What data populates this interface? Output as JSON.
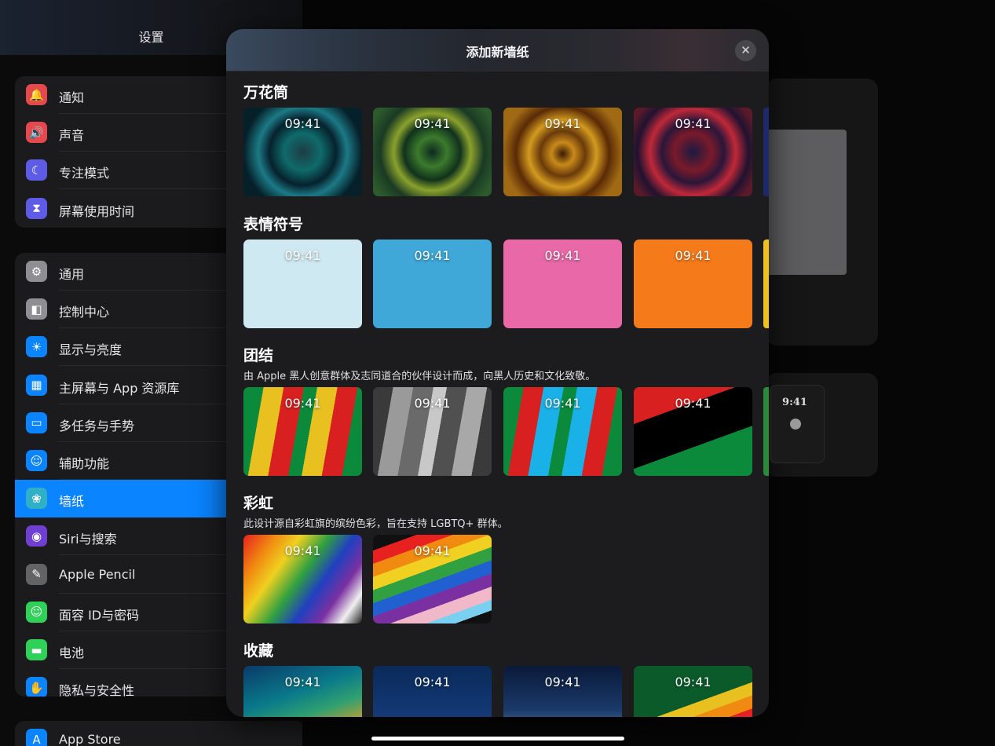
{
  "sidebar": {
    "title": "设置",
    "groups": [
      {
        "items": [
          {
            "label": "通知",
            "icon": "bell-icon",
            "color": "#e5484d",
            "glyph": "🔔"
          },
          {
            "label": "声音",
            "icon": "speaker-icon",
            "color": "#e5484d",
            "glyph": "🔊"
          },
          {
            "label": "专注模式",
            "icon": "moon-icon",
            "color": "#5e5ce6",
            "glyph": "☾"
          },
          {
            "label": "屏幕使用时间",
            "icon": "hourglass-icon",
            "color": "#5e5ce6",
            "glyph": "⧗"
          }
        ]
      },
      {
        "items": [
          {
            "label": "通用",
            "icon": "gear-icon",
            "color": "#8e8e93",
            "glyph": "⚙"
          },
          {
            "label": "控制中心",
            "icon": "switches-icon",
            "color": "#8e8e93",
            "glyph": "◧"
          },
          {
            "label": "显示与亮度",
            "icon": "sun-icon",
            "color": "#0a84ff",
            "glyph": "☀"
          },
          {
            "label": "主屏幕与 App 资源库",
            "icon": "home-screen-icon",
            "color": "#0a84ff",
            "glyph": "▦"
          },
          {
            "label": "多任务与手势",
            "icon": "multitasking-icon",
            "color": "#0a84ff",
            "glyph": "▭"
          },
          {
            "label": "辅助功能",
            "icon": "accessibility-icon",
            "color": "#0a84ff",
            "glyph": "☺"
          },
          {
            "label": "墙纸",
            "icon": "flower-icon",
            "color": "#30b0c7",
            "glyph": "❀",
            "selected": true
          },
          {
            "label": "Siri与搜索",
            "icon": "siri-icon",
            "color": "#6e3fd1",
            "glyph": "◉"
          },
          {
            "label": "Apple Pencil",
            "icon": "pencil-icon",
            "color": "#636366",
            "glyph": "✎"
          },
          {
            "label": "面容 ID与密码",
            "icon": "face-id-icon",
            "color": "#30d158",
            "glyph": "☺"
          },
          {
            "label": "电池",
            "icon": "battery-icon",
            "color": "#30d158",
            "glyph": "▬"
          },
          {
            "label": "隐私与安全性",
            "icon": "hand-icon",
            "color": "#0a84ff",
            "glyph": "✋"
          }
        ]
      },
      {
        "items": [
          {
            "label": "App Store",
            "icon": "app-store-icon",
            "color": "#0a84ff",
            "glyph": "A"
          }
        ]
      }
    ]
  },
  "modal": {
    "title": "添加新墙纸",
    "close_icon": "close-icon",
    "sections": [
      {
        "title": "万花筒",
        "desc": "",
        "count": 4,
        "peek_color": "#1c2a6a",
        "thumbs": [
          {
            "time": "09:41",
            "bg": "radial-gradient(circle at 50% 50%, #1d3c46 0%, #0f6a6a 25%, #06222e 45%, #1b7a86 60%, #052029 80%)"
          },
          {
            "time": "09:41",
            "bg": "radial-gradient(circle at 50% 50%, #0d2a20 0%, #3c7a2c 20%, #10321d 38%, #8aa12c 52%, #1a3a24 70%, #2c5a2c 90%)"
          },
          {
            "time": "09:41",
            "bg": "radial-gradient(circle at 50% 52%, #3a1a05 0%, #c88a1a 15%, #6a3a0a 30%, #d39a20 45%, #5a2a06 62%, #a06a14 80%)"
          },
          {
            "time": "09:41",
            "bg": "radial-gradient(circle at 50% 50%, #1a1a40 0%, #7a1a2a 25%, #2a163a 42%, #c02838 58%, #201230 75%, #5a1a2a 90%)"
          }
        ]
      },
      {
        "title": "表情符号",
        "desc": "",
        "count": 4,
        "peek_color": "#f0c020",
        "thumbs": [
          {
            "time": "09:41",
            "bg": "#cfe9f2"
          },
          {
            "time": "09:41",
            "bg": "#3fa8d8"
          },
          {
            "time": "09:41",
            "bg": "#e868a8"
          },
          {
            "time": "09:41",
            "bg": "#f47a1a"
          }
        ]
      },
      {
        "title": "团结",
        "desc": "由 Apple 黑人创意群体及志同道合的伙伴设计而成，向黑人历史和文化致敬。",
        "count": 4,
        "peek_color": "#2a8a3a",
        "thumbs": [
          {
            "time": "09:41",
            "bg": "linear-gradient(100deg, #0a8a3a 0 15%, #e8c020 15% 30%, #d82020 30% 45%, #0a8a3a 45% 55%, #e8c020 55% 70%, #d82020 70% 85%, #0a8a3a 85%)"
          },
          {
            "time": "09:41",
            "bg": "linear-gradient(100deg, #3a3a3a 0 15%, #9a9a9a 15% 30%, #6a6a6a 30% 45%, #c8c8c8 45% 55%, #505050 55% 70%, #a8a8a8 70% 85%, #3a3a3a 85%)"
          },
          {
            "time": "09:41",
            "bg": "linear-gradient(100deg, #0a8a3a 0 15%, #d82020 15% 30%, #1ab0e8 30% 45%, #0a8a3a 45% 55%, #1ab0e8 55% 70%, #d82020 70% 85%, #0a8a3a 85%)"
          },
          {
            "time": "09:41",
            "bg": "linear-gradient(160deg, #d82020 0 28%, #000 28% 62%, #0a8a3a 62%)"
          }
        ]
      },
      {
        "title": "彩虹",
        "desc": "此设计源自彩虹旗的缤纷色彩，旨在支持 LGBTQ+ 群体。",
        "count": 2,
        "peek_color": "",
        "thumbs": [
          {
            "time": "09:41",
            "bg": "linear-gradient(125deg, #e82020 0%, #f08a10 18%, #f0d020 32%, #30a040 48%, #2040c0 62%, #7a30a0 76%, #f0f0f0 88%, #202020 100%)"
          },
          {
            "time": "09:41",
            "bg": "linear-gradient(160deg, #101010 0 12%, #e82020 12% 22%, #f08a10 22% 32%, #f0d020 32% 42%, #30a040 42% 52%, #2060d0 52% 62%, #7a30a0 62% 72%, #f0b8c8 72% 82%, #7ad0f0 82% 90%, #101010 90%)"
          }
        ]
      },
      {
        "title": "收藏",
        "desc": "",
        "count": 4,
        "peek_color": "",
        "thumbs": [
          {
            "time": "09:41",
            "bg": "linear-gradient(160deg, #0a3a6a 0%, #0a7a8a 35%, #30a070 55%, #e8a020 80%, #e85a2a 100%)"
          },
          {
            "time": "09:41",
            "bg": "linear-gradient(180deg, #0a2a5a 0%, #143a78 60%, #0a1a3a 100%)"
          },
          {
            "time": "09:41",
            "bg": "linear-gradient(180deg, #0a1a3a 0%, #1a3a6a 50%, #8aa8c8 100%)"
          },
          {
            "time": "09:41",
            "bg": "linear-gradient(160deg, #0a5a2a 0 45%, #e8c020 45% 55%, #f08a10 55% 65%, #e82020 65% 75%, #c02060 75% 85%, #5a30a0 85%)"
          }
        ]
      }
    ]
  },
  "colors": {
    "selected": "#0a84ff",
    "sheet": "#1c1c1e",
    "sidebar_group": "#1b1b1d"
  }
}
